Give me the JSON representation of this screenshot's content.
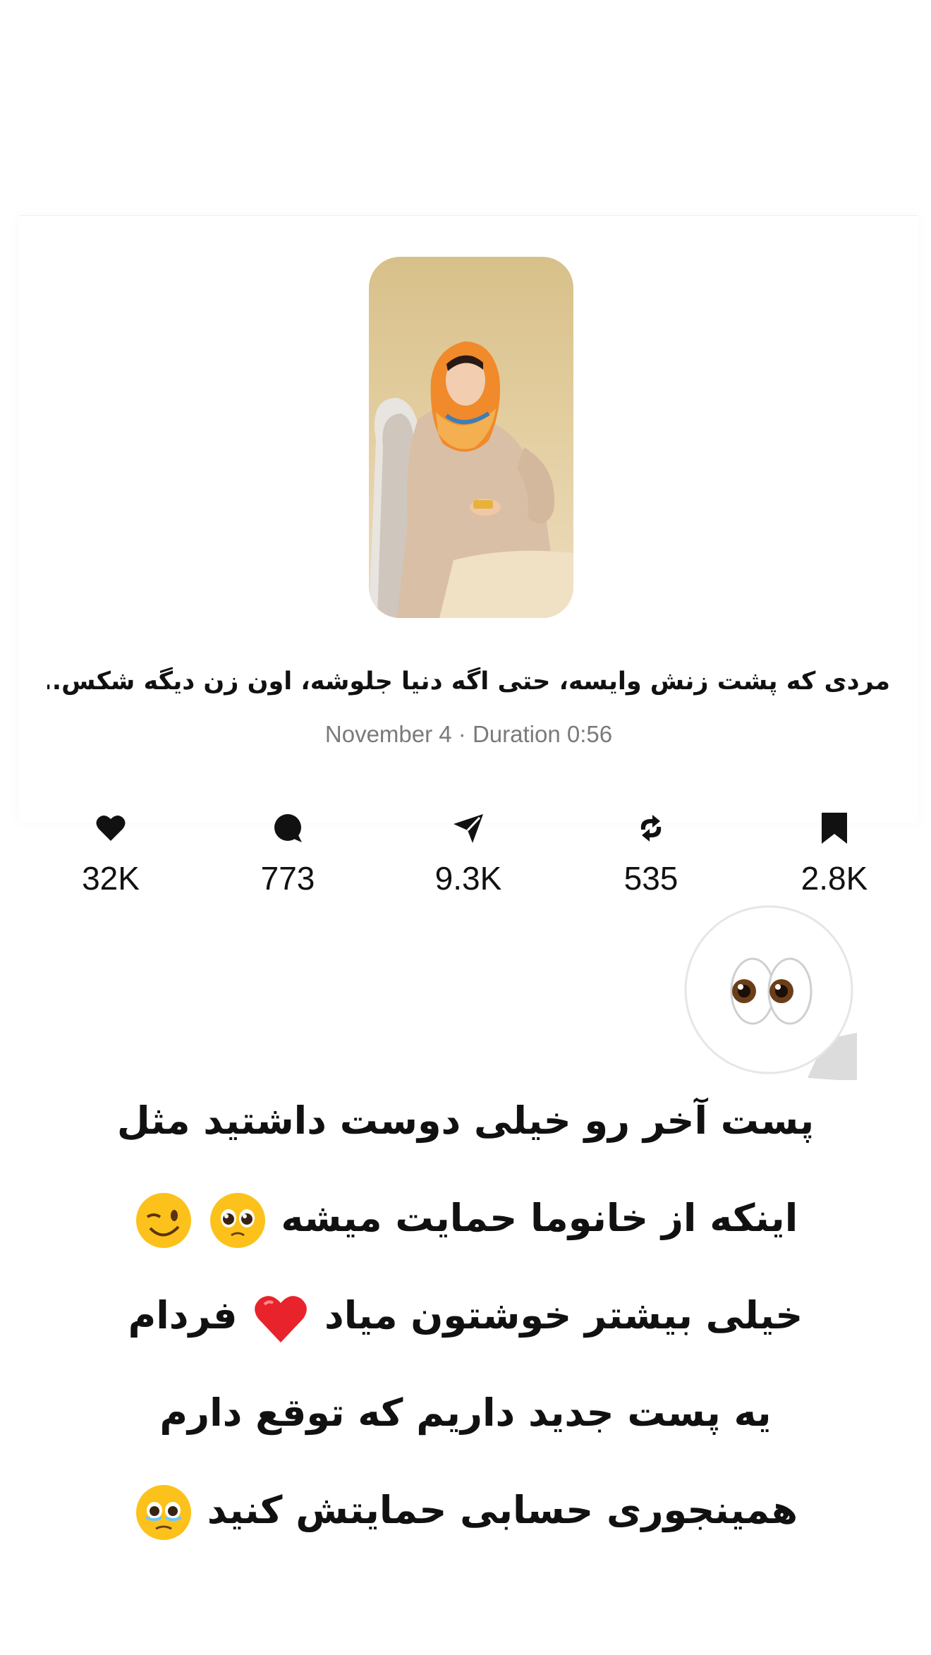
{
  "post": {
    "caption": "مردی که پشت زنش وایسه، حتی اگه دنیا جلوشه، اون زن دیگه شکس...",
    "meta": "November 4 · Duration 0:56"
  },
  "stats": [
    {
      "icon": "heart-icon",
      "value": "32K"
    },
    {
      "icon": "comment-icon",
      "value": "773"
    },
    {
      "icon": "share-icon",
      "value": "9.3K"
    },
    {
      "icon": "repost-icon",
      "value": "535"
    },
    {
      "icon": "bookmark-icon",
      "value": "2.8K"
    }
  ],
  "sticker": {
    "icon": "eyes-emoji"
  },
  "story_text": {
    "line1": "پست آخر رو خیلی دوست داشتید مثل",
    "line2": "اینکه از خانوما حمایت میشه",
    "line3a": "خیلی بیشتر خوشتون میاد",
    "line3b": "فردام",
    "line4": "یه پست جدید داریم که توقع دارم",
    "line5": "همینجوری حسابی حمایتش کنید"
  },
  "emojis": {
    "pleading": "pleading-face-emoji",
    "wink": "winking-face-emoji",
    "heart": "red-heart-emoji",
    "teary": "holding-back-tears-emoji"
  },
  "colors": {
    "text": "#111111",
    "meta": "#7a7a7a",
    "heart": "#e8232b",
    "emoji_yellow": "#fcc21b"
  }
}
